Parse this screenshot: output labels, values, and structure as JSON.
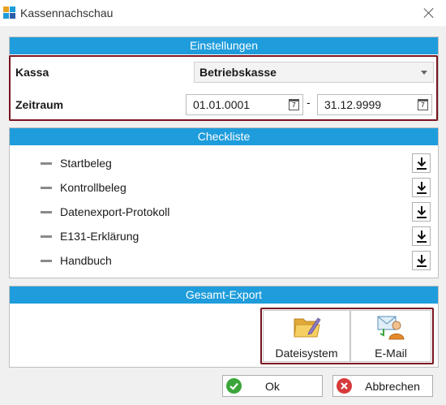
{
  "window": {
    "title": "Kassennachschau"
  },
  "settings": {
    "header": "Einstellungen",
    "kassa_label": "Kassa",
    "kassa_value": "Betriebskasse",
    "period_label": "Zeitraum",
    "date_from": "01.01.0001",
    "date_separator": "-",
    "date_to": "31.12.9999",
    "calendar_day": "7"
  },
  "checklist": {
    "header": "Checkliste",
    "items": [
      {
        "label": "Startbeleg"
      },
      {
        "label": "Kontrollbeleg"
      },
      {
        "label": "Datenexport-Protokoll"
      },
      {
        "label": "E131-Erklärung"
      },
      {
        "label": "Handbuch"
      }
    ]
  },
  "export": {
    "header": "Gesamt-Export",
    "filesystem_label": "Dateisystem",
    "email_label": "E-Mail"
  },
  "footer": {
    "ok_label": "Ok",
    "cancel_label": "Abbrechen"
  },
  "colors": {
    "header_blue": "#1e9cdb",
    "highlight": "#7a1420",
    "ok_green": "#3aa63a",
    "cancel_red": "#d63a3a"
  }
}
